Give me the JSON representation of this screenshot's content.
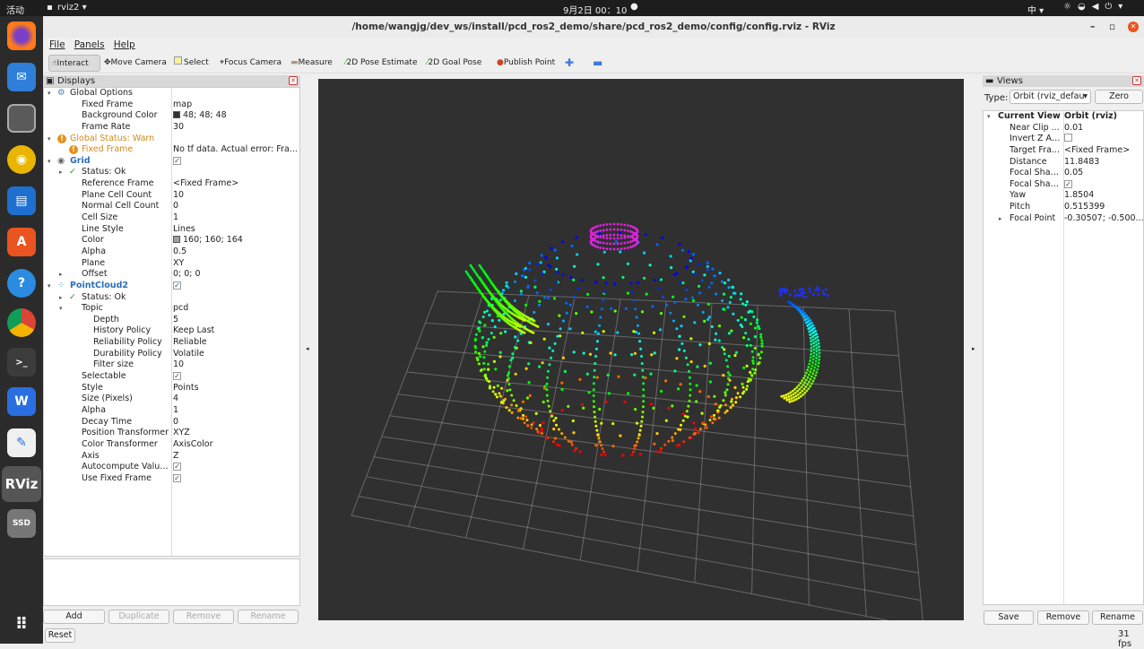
{
  "topbar": {
    "activities": "活动",
    "app": "rvlz2 ▾",
    "app_label": "rviz2",
    "clock": "9月2日  00：10",
    "ime": "中 ▾"
  },
  "dock": {
    "items": [
      "firefox",
      "thunderbird",
      "files",
      "rhythmbox",
      "writer",
      "software",
      "help",
      "chrome",
      "terminal",
      "wps",
      "text-editor",
      "rviz",
      "ssd",
      "apps"
    ]
  },
  "window": {
    "title": "/home/wangjg/dev_ws/install/pcd_ros2_demo/share/pcd_ros2_demo/config/config.rviz - RViz"
  },
  "menu": [
    "File",
    "Panels",
    "Help"
  ],
  "toolbar": [
    "Interact",
    "Move Camera",
    "Select",
    "Focus Camera",
    "Measure",
    "2D Pose Estimate",
    "2D Goal Pose",
    "Publish Point"
  ],
  "displays": {
    "title": "Displays",
    "rows": [
      {
        "d": 0,
        "exp": "▾",
        "icon": "gear",
        "k": "Global Options",
        "v": ""
      },
      {
        "d": 1,
        "k": "Fixed Frame",
        "v": "map"
      },
      {
        "d": 1,
        "k": "Background Color",
        "v": "48; 48; 48",
        "sw": "#303030"
      },
      {
        "d": 1,
        "k": "Frame Rate",
        "v": "30"
      },
      {
        "d": 0,
        "exp": "▾",
        "icon": "warn",
        "k": "Global Status: Warn",
        "v": "",
        "c": "#d08a1a"
      },
      {
        "d": 1,
        "icon": "warn",
        "k": "Fixed Frame",
        "v": "No tf data.  Actual error: Fra...",
        "c": "#d08a1a"
      },
      {
        "d": 0,
        "exp": "▾",
        "icon": "eye",
        "k": "Grid",
        "v": "✓",
        "chk": true,
        "c": "#2a6fb8",
        "b": true
      },
      {
        "d": 1,
        "exp": "▸",
        "icon": "ok",
        "k": "Status: Ok",
        "v": ""
      },
      {
        "d": 1,
        "k": "Reference Frame",
        "v": "<Fixed Frame>"
      },
      {
        "d": 1,
        "k": "Plane Cell Count",
        "v": "10"
      },
      {
        "d": 1,
        "k": "Normal Cell Count",
        "v": "0"
      },
      {
        "d": 1,
        "k": "Cell Size",
        "v": "1"
      },
      {
        "d": 1,
        "k": "Line Style",
        "v": "Lines"
      },
      {
        "d": 1,
        "k": "Color",
        "v": "160; 160; 164",
        "sw": "#a0a0a4"
      },
      {
        "d": 1,
        "k": "Alpha",
        "v": "0.5"
      },
      {
        "d": 1,
        "k": "Plane",
        "v": "XY"
      },
      {
        "d": 1,
        "exp": "▸",
        "k": "Offset",
        "v": "0; 0; 0"
      },
      {
        "d": 0,
        "exp": "▾",
        "icon": "cloud",
        "k": "PointCloud2",
        "v": "✓",
        "chk": true,
        "c": "#2a6fb8",
        "b": true
      },
      {
        "d": 1,
        "exp": "▸",
        "icon": "ok",
        "k": "Status: Ok",
        "v": ""
      },
      {
        "d": 1,
        "exp": "▾",
        "k": "Topic",
        "v": "pcd"
      },
      {
        "d": 2,
        "k": "Depth",
        "v": "5"
      },
      {
        "d": 2,
        "k": "History Policy",
        "v": "Keep Last"
      },
      {
        "d": 2,
        "k": "Reliability Policy",
        "v": "Reliable"
      },
      {
        "d": 2,
        "k": "Durability Policy",
        "v": "Volatile"
      },
      {
        "d": 2,
        "k": "Filter size",
        "v": "10"
      },
      {
        "d": 1,
        "k": "Selectable",
        "v": "✓",
        "chk": true
      },
      {
        "d": 1,
        "k": "Style",
        "v": "Points"
      },
      {
        "d": 1,
        "k": "Size (Pixels)",
        "v": "4"
      },
      {
        "d": 1,
        "k": "Alpha",
        "v": "1"
      },
      {
        "d": 1,
        "k": "Decay Time",
        "v": "0"
      },
      {
        "d": 1,
        "k": "Position Transformer",
        "v": "XYZ"
      },
      {
        "d": 1,
        "k": "Color Transformer",
        "v": "AxisColor"
      },
      {
        "d": 1,
        "k": "Axis",
        "v": "Z"
      },
      {
        "d": 1,
        "k": "Autocompute Value B...",
        "v": "✓",
        "chk": true
      },
      {
        "d": 1,
        "k": "Use Fixed Frame",
        "v": "✓",
        "chk": true
      }
    ],
    "buttons": {
      "add": "Add",
      "duplicate": "Duplicate",
      "remove": "Remove",
      "rename": "Rename"
    },
    "reset": "Reset"
  },
  "views": {
    "title": "Views",
    "type_label": "Type:",
    "type_value": "Orbit (rviz_defau",
    "zero": "Zero",
    "rows": [
      {
        "d": 0,
        "exp": "▾",
        "k": "Current View",
        "v": "Orbit (rviz)",
        "b": true
      },
      {
        "d": 1,
        "k": "Near Clip ...",
        "v": "0.01"
      },
      {
        "d": 1,
        "k": "Invert Z Axis",
        "v": "",
        "chk": true
      },
      {
        "d": 1,
        "k": "Target Fra...",
        "v": "<Fixed Frame>"
      },
      {
        "d": 1,
        "k": "Distance",
        "v": "11.8483"
      },
      {
        "d": 1,
        "k": "Focal Shap...",
        "v": "0.05"
      },
      {
        "d": 1,
        "k": "Focal Shap...",
        "v": "✓",
        "chk": true
      },
      {
        "d": 1,
        "k": "Yaw",
        "v": "1.8504"
      },
      {
        "d": 1,
        "k": "Pitch",
        "v": "0.515399"
      },
      {
        "d": 1,
        "exp": "▸",
        "k": "Focal Point",
        "v": "-0.30507; -0.500..."
      }
    ],
    "buttons": {
      "save": "Save",
      "remove": "Remove",
      "rename": "Rename"
    }
  },
  "status": {
    "fps": "31 fps"
  },
  "scene": {
    "background": "#303030",
    "grid_color": "#a0a0a4",
    "grid_cells": 10
  }
}
